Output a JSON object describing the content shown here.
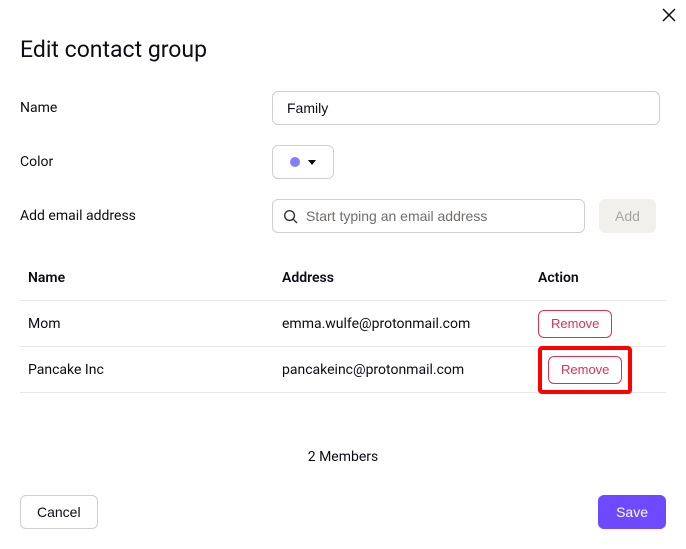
{
  "dialog": {
    "title": "Edit contact group"
  },
  "fields": {
    "name_label": "Name",
    "name_value": "Family",
    "color_label": "Color",
    "color_value": "#8080ff",
    "add_email_label": "Add email address",
    "add_email_placeholder": "Start typing an email address",
    "add_btn_label": "Add"
  },
  "table": {
    "headers": {
      "name": "Name",
      "address": "Address",
      "action": "Action"
    },
    "rows": [
      {
        "name": "Mom",
        "address": "emma.wulfe@protonmail.com",
        "remove": "Remove",
        "highlighted": false
      },
      {
        "name": "Pancake Inc",
        "address": "pancakeinc@protonmail.com",
        "remove": "Remove",
        "highlighted": true
      }
    ]
  },
  "members_count": "2 Members",
  "footer": {
    "cancel": "Cancel",
    "save": "Save"
  }
}
